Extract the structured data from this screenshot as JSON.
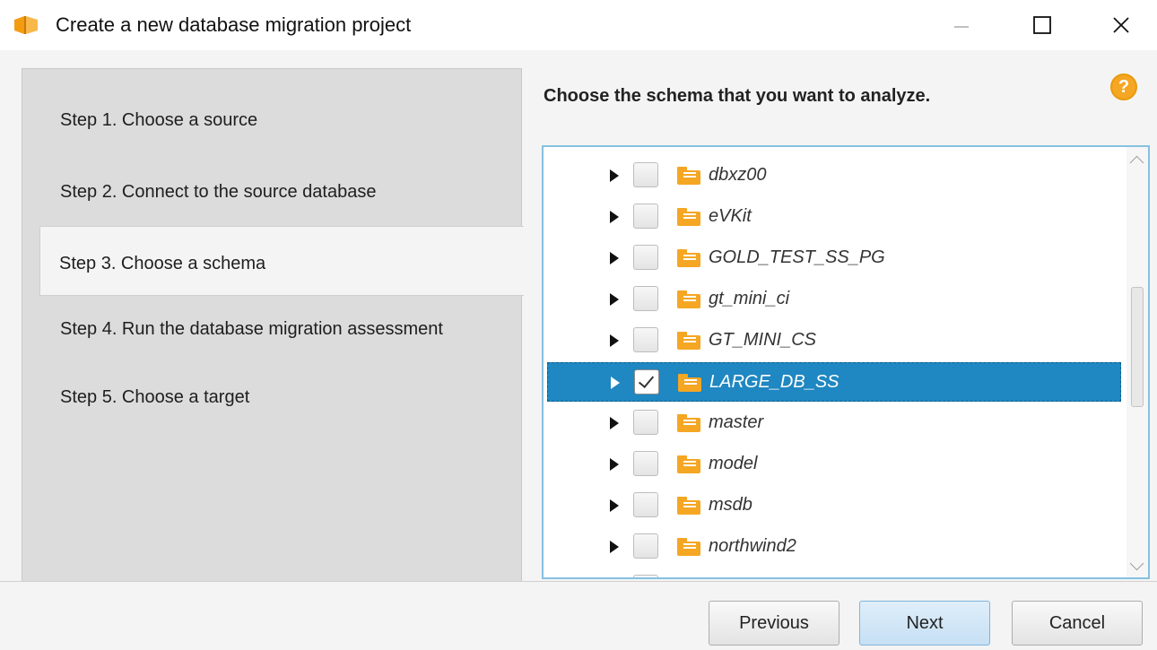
{
  "window": {
    "title": "Create a new database migration project",
    "controls": {
      "minimize": "minimize",
      "maximize": "maximize",
      "close": "close"
    }
  },
  "steps": [
    {
      "label": "Step 1. Choose a source",
      "active": false
    },
    {
      "label": "Step 2. Connect to the source database",
      "active": false
    },
    {
      "label": "Step 3. Choose a schema",
      "active": true
    },
    {
      "label": "Step 4. Run the database migration assessment",
      "active": false
    },
    {
      "label": "Step 5. Choose a target",
      "active": false
    }
  ],
  "main": {
    "prompt": "Choose the schema that you want to analyze.",
    "help_icon": "?",
    "schemas": [
      {
        "name": "dbxz00",
        "checked": false,
        "selected": false
      },
      {
        "name": "eVKit",
        "checked": false,
        "selected": false
      },
      {
        "name": "GOLD_TEST_SS_PG",
        "checked": false,
        "selected": false
      },
      {
        "name": "gt_mini_ci",
        "checked": false,
        "selected": false
      },
      {
        "name": "GT_MINI_CS",
        "checked": false,
        "selected": false
      },
      {
        "name": "LARGE_DB_SS",
        "checked": true,
        "selected": true
      },
      {
        "name": "master",
        "checked": false,
        "selected": false
      },
      {
        "name": "model",
        "checked": false,
        "selected": false
      },
      {
        "name": "msdb",
        "checked": false,
        "selected": false
      },
      {
        "name": "northwind2",
        "checked": false,
        "selected": false
      }
    ]
  },
  "footer": {
    "previous_label": "Previous",
    "next_label": "Next",
    "cancel_label": "Cancel"
  },
  "colors": {
    "accent": "#1f87c1",
    "schema_icon": "#f5a623",
    "help_icon": "#f5a623"
  }
}
